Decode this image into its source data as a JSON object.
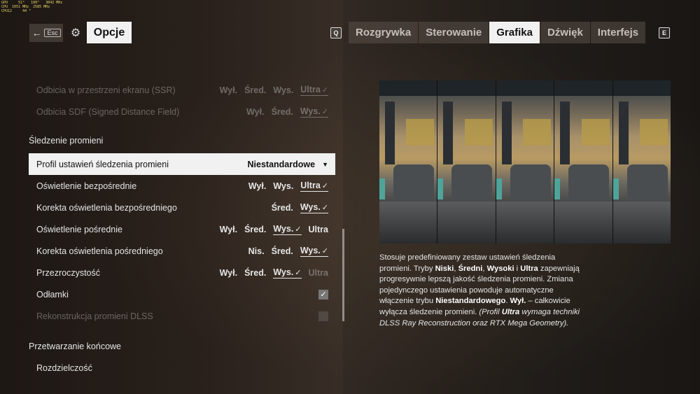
{
  "perf_overlay": [
    "GPU     51°   100°   3042 MHz",
    "CPU  1051 MHz  2585 MHz",
    "CPU12     44 °"
  ],
  "header": {
    "back_key": "Esc",
    "title": "Opcje",
    "tab_prev_key": "Q",
    "tab_next_key": "E",
    "tabs": [
      {
        "label": "Rozgrywka",
        "active": false
      },
      {
        "label": "Sterowanie",
        "active": false
      },
      {
        "label": "Grafika",
        "active": true
      },
      {
        "label": "Dźwięk",
        "active": false
      },
      {
        "label": "Interfejs",
        "active": false
      }
    ]
  },
  "settings": {
    "top_rows": [
      {
        "label": "Odbicia w przestrzeni ekranu (SSR)",
        "options": [
          "Wył.",
          "Śred.",
          "Wys.",
          "Ultra"
        ],
        "selected": 3
      },
      {
        "label": "Odbicia SDF (Signed Distance Field)",
        "options": [
          "Wył.",
          "Śred.",
          "Wys."
        ],
        "selected": 2
      }
    ],
    "section_ray": "Śledzenie promieni",
    "profile": {
      "label": "Profil ustawień śledzenia promieni",
      "value": "Niestandardowe"
    },
    "ray_rows": [
      {
        "label": "Oświetlenie bezpośrednie",
        "options": [
          "Wył.",
          "Wys.",
          "Ultra"
        ],
        "selected": 2
      },
      {
        "label": "Korekta oświetlenia bezpośredniego",
        "options": [
          "Śred.",
          "Wys."
        ],
        "selected": 1
      },
      {
        "label": "Oświetlenie pośrednie",
        "options": [
          "Wył.",
          "Śred.",
          "Wys.",
          "Ultra"
        ],
        "selected": 2
      },
      {
        "label": "Korekta oświetlenia pośredniego",
        "options": [
          "Nis.",
          "Śred.",
          "Wys."
        ],
        "selected": 2
      },
      {
        "label": "Przezroczystość",
        "options": [
          "Wył.",
          "Śred.",
          "Wys.",
          "Ultra"
        ],
        "selected": 2
      }
    ],
    "debris": {
      "label": "Odłamki",
      "checked": true
    },
    "dlss": {
      "label": "Rekonstrukcja promieni DLSS",
      "checked": false
    },
    "section_post": "Przetwarzanie końcowe",
    "resolution": {
      "label": "Rozdzielczość"
    }
  },
  "description": {
    "p1": "Stosuje predefiniowany zestaw ustawień śledzenia promieni. Tryby ",
    "niski": "Niski",
    "c1": ", ",
    "sredni": "Średni",
    "c2": ", ",
    "wysoki": "Wysoki",
    "c3": " i ",
    "ultra": "Ultra",
    "p2": " zapewniają progresywnie lepszą jakość śledzenia promieni. Zmiana pojedynczego ustawienia powoduje automatyczne włączenie trybu ",
    "niestandardowy": "Niestandardowego",
    "p3": ". ",
    "wyl": "Wył.",
    "p4": " – całkowicie wyłącza śledzenie promieni. ",
    "i1": "(Profil ",
    "i_ultra": "Ultra",
    "i2": " wymaga techniki DLSS Ray Reconstruction oraz RTX Mega Geometry)."
  },
  "colors": {
    "highlight": "#f1f1f1",
    "accent_text": "#111111"
  }
}
